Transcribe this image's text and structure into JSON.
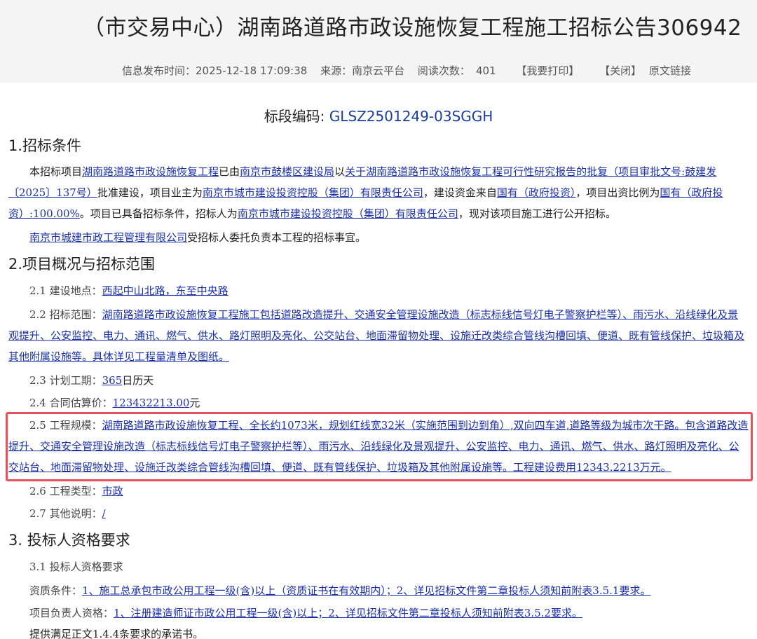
{
  "header": {
    "title": "（市交易中心）湖南路道路市政设施恢复工程施工招标公告306942",
    "publish_label": "信息发布时间：",
    "publish_time": "2025-12-18 17:09:38",
    "source_label": "来源：",
    "source": "南京云平台",
    "views_label": "阅读次数：",
    "views": "401",
    "print_label": "【我要打印】",
    "close_label": "【关闭】",
    "original_link": "原文链接"
  },
  "code_section": {
    "label": "标段编码:",
    "code": "GLSZ2501249-03SGGH"
  },
  "s1": {
    "heading": "1.招标条件",
    "p1_a": "本招标项目",
    "p1_link1": "湖南路道路市政设施恢复工程",
    "p1_b": "已由",
    "p1_link2": "南京市鼓楼区建设局",
    "p1_c": "以",
    "p1_link3": "关于湖南路道路市政设施恢复工程可行性研究报告的批复（项目审批文号:鼓建发〔2025〕137号）",
    "p1_d": "批准建设，项目业主为",
    "p1_link4": "南京市城市建设投资控股（集团）有限责任公司",
    "p1_e": "，建设资金来自",
    "p1_link5": "国有（政府投资）",
    "p1_f": "，项目出资比例为",
    "p1_link6": "国有（政府投资）:100.00%",
    "p1_g": "。项目已具备招标条件，招标人为",
    "p1_link7": "南京市城市建设投资控股（集团）有限责任公司",
    "p1_h": "，现对该项目施工进行公开招标。",
    "p2_link": "南京市城建市政工程管理有限公司",
    "p2_text": "受招标人委托负责本工程的招标事宜。"
  },
  "s2": {
    "heading": "2.项目概况与招标范围",
    "r1_label": "2.1 建设地点：",
    "r1_value": "西起中山北路，东至中央路",
    "r2_label": "2.2 招标范围：",
    "r2_value": "湖南路道路市政设施恢复工程施工包括道路改造提升、交通安全管理设施改造（标志标线信号灯电子警察护栏等）、雨污水、沿线绿化及景观提升、公安监控、电力、通讯、燃气、供水、路灯照明及亮化、公交站台、地面滞留物处理、设施迁改类综合管线沟槽回填、便道、既有管线保护、垃圾箱及其他附属设施等。具体详见工程量清单及图纸。",
    "r3_label": "2.3 计划工期：",
    "r3_value": "365",
    "r3_suffix": "日历天",
    "r4_label": "2.4 合同估算价：",
    "r4_value": "123432213.00",
    "r4_suffix": "元",
    "r5_label": "2.5 工程规模：",
    "r5_value": "湖南路道路市政设施恢复工程、全长约1073米，规划红线宽32米（实施范围到边到角）,双向四车道,道路等级为城市次干路。包含道路改造提升、交通安全管理设施改造（标志标线信号灯电子警察护栏等）、雨污水、沿线绿化及景观提升、公安监控、电力、通讯、燃气、供水、路灯照明及亮化、公交站台、地面滞留物处理、设施迁改类综合管线沟槽回填、便道、既有管线保护、垃圾箱及其他附属设施等。工程建设费用12343.2213万元。",
    "r6_label": "2.6 工程类型：",
    "r6_value": "市政",
    "r7_label": "2.7 其他说明：",
    "r7_value": "/"
  },
  "s3": {
    "heading": "3. 投标人资格要求",
    "sub_label": "3.1 投标人资格要求",
    "q1_label": "资质条件：",
    "q1_value": "1、施工总承包市政公用工程一级(含)以上（资质证书在有效期内）；2、详见招标文件第二章投标人须知前附表3.5.1要求。",
    "q2_label": "项目负责人资格：",
    "q2_value": "1、注册建造师证市政公用工程一级(含)以上；2、详见招标文件第二章投标人须知前附表3.5.2要求。",
    "q3_text": "提供满足正文1.4.4条要求的承诺书。"
  }
}
